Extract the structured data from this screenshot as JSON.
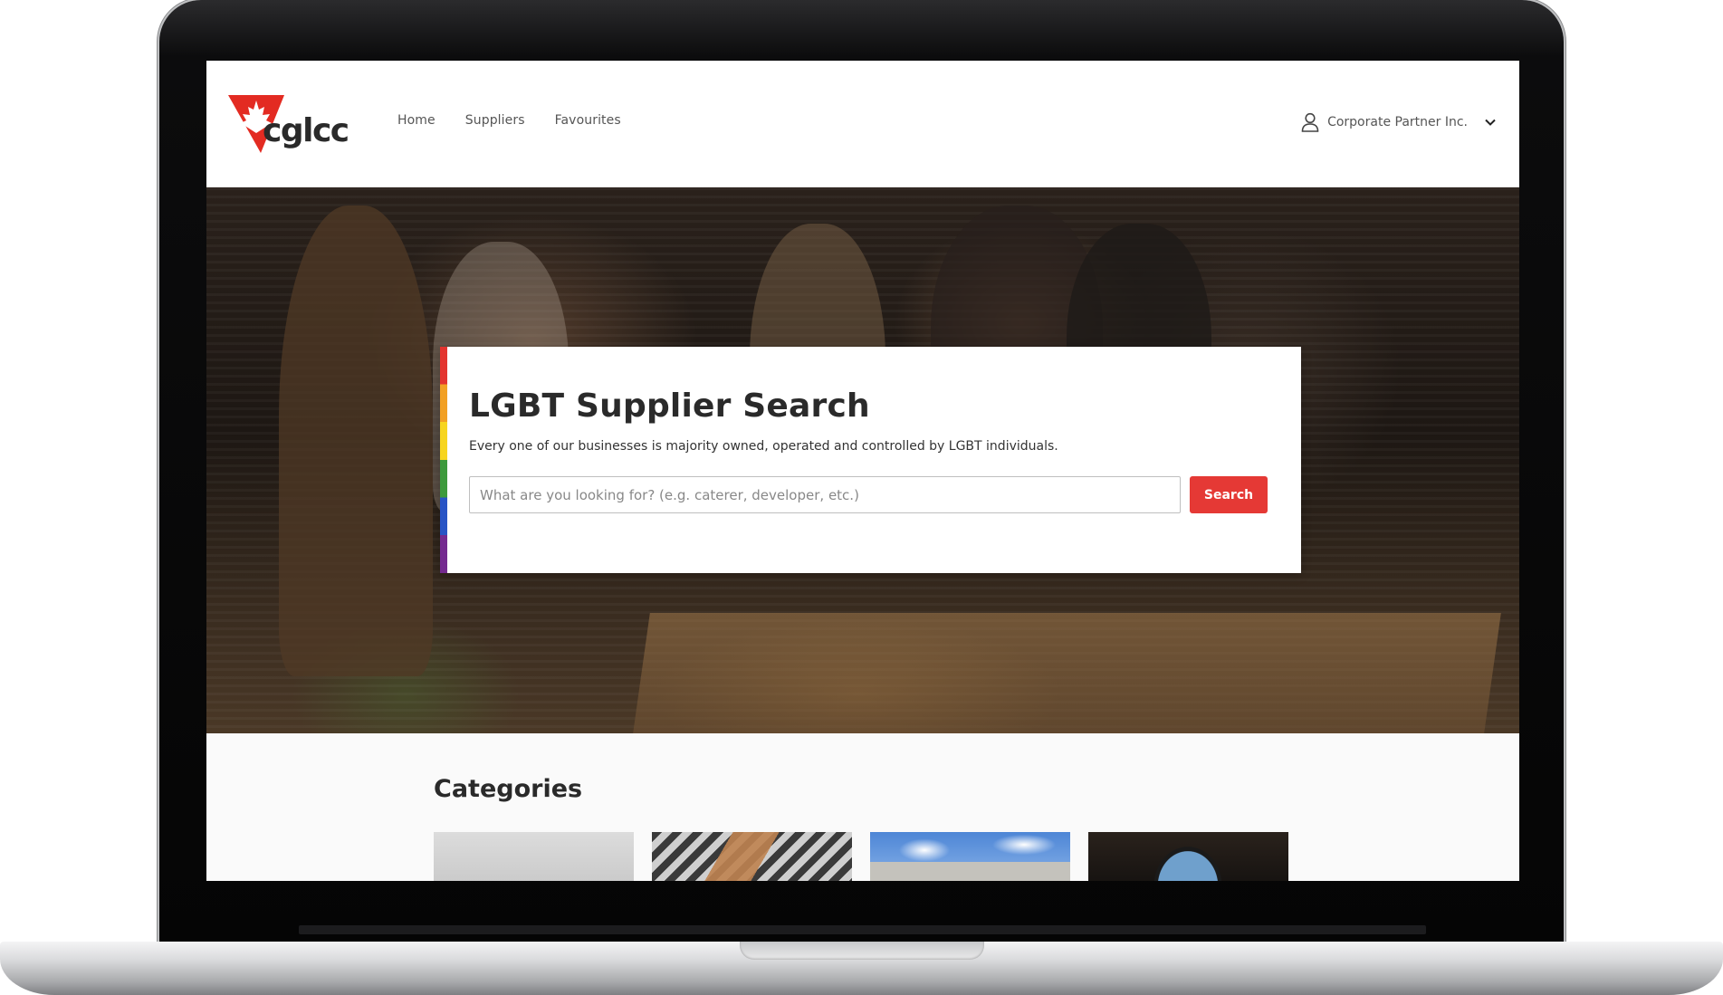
{
  "header": {
    "logo_text": "cglcc",
    "nav": [
      {
        "label": "Home"
      },
      {
        "label": "Suppliers"
      },
      {
        "label": "Favourites"
      }
    ],
    "account_label": "Corporate Partner Inc."
  },
  "hero": {
    "title": "LGBT Supplier Search",
    "subtitle": "Every one of our businesses is majority owned, operated and controlled by LGBT individuals.",
    "search_placeholder": "What are you looking for? (e.g. caterer, developer, etc.)",
    "search_button": "Search"
  },
  "categories": {
    "title": "Categories"
  },
  "colors": {
    "accent": "#e53935",
    "logo_red": "#e32b22",
    "text": "#2a2a2a",
    "rainbow": [
      "#e3342f",
      "#f2a024",
      "#f7d51f",
      "#3d9a3c",
      "#2854c5",
      "#742a8f"
    ]
  }
}
